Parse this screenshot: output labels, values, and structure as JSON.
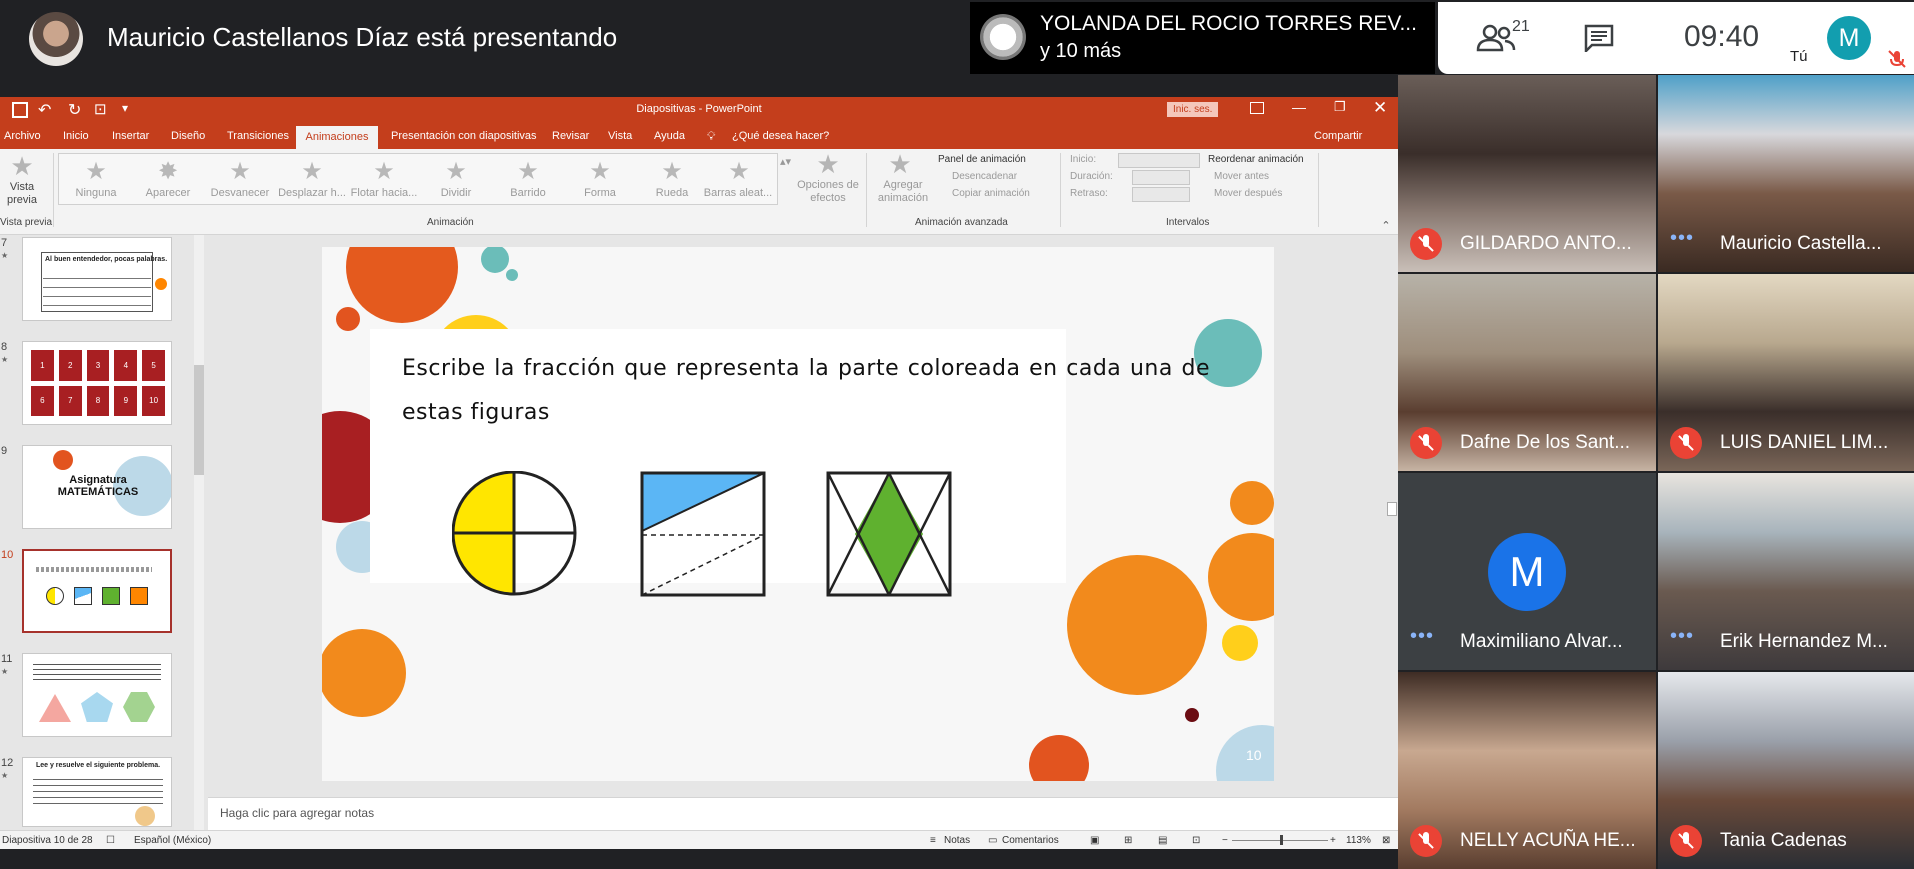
{
  "meet": {
    "presenter_text": "Mauricio Castellanos Díaz está presentando",
    "speaker": {
      "name": "YOLANDA DEL ROCIO TORRES REV...",
      "more": "y 10 más"
    },
    "participants_count": "21",
    "clock": "09:40",
    "self_label": "Tú",
    "self_initial": "M"
  },
  "ppt": {
    "doc_title": "Diapositivas - PowerPoint",
    "signin": "Inic. ses.",
    "tabs": [
      "Archivo",
      "Inicio",
      "Insertar",
      "Diseño",
      "Transiciones",
      "Animaciones",
      "Presentación con diapositivas",
      "Revisar",
      "Vista",
      "Ayuda"
    ],
    "active_tab": "Animaciones",
    "tell_me": "¿Qué desea hacer?",
    "share": "Compartir",
    "ribbon": {
      "preview": "Vista previa",
      "preview_group": "Vista previa",
      "animations": [
        "Ninguna",
        "Aparecer",
        "Desvanecer",
        "Desplazar h...",
        "Flotar hacia...",
        "Dividir",
        "Barrido",
        "Forma",
        "Rueda",
        "Barras aleat..."
      ],
      "effect_options": "Opciones de efectos",
      "animation_group": "Animación",
      "add_animation": "Agregar animación",
      "animation_pane": "Panel de animación",
      "trigger": "Desencadenar",
      "copy_animation": "Copiar animación",
      "advanced_group": "Animación avanzada",
      "start": "Inicio:",
      "duration": "Duración:",
      "delay": "Retraso:",
      "timing_group": "Intervalos",
      "reorder": "Reordenar animación",
      "move_earlier": "Mover antes",
      "move_later": "Mover después"
    },
    "thumbnails": [
      {
        "num": "7",
        "text": "Al buen entendedor, pocas palabras."
      },
      {
        "num": "8",
        "cells": [
          "1",
          "2",
          "3",
          "4",
          "5",
          "6",
          "7",
          "8",
          "9",
          "10"
        ]
      },
      {
        "num": "9",
        "text": "Asignatura MATEMÁTICAS"
      },
      {
        "num": "10"
      },
      {
        "num": "11"
      },
      {
        "num": "12",
        "text": "Lee y resuelve el siguiente problema."
      }
    ],
    "slide": {
      "instruction": "Escribe la fracción que representa la parte coloreada en cada una de estas figuras",
      "number": "10"
    },
    "notes_placeholder": "Haga clic para agregar notas",
    "status": {
      "slide_info": "Diapositiva 10 de 28",
      "language": "Español (México)",
      "notes": "Notas",
      "comments": "Comentarios",
      "zoom": "113%"
    },
    "colors": {
      "accent": "#c43e1c",
      "yellow": "#ffe600",
      "blue": "#5bb6f5",
      "green": "#5fb12f",
      "orange": "#ff8600"
    }
  },
  "tiles": [
    {
      "name": "GILDARDO ANTO...",
      "muted": true
    },
    {
      "name": "Mauricio Castella...",
      "muted": false
    },
    {
      "name": "Dafne De los Sant...",
      "muted": true
    },
    {
      "name": "LUIS DANIEL LIM...",
      "muted": true
    },
    {
      "name": "Maximiliano Alvar...",
      "muted": false,
      "initial": "M"
    },
    {
      "name": "Erik Hernandez M...",
      "muted": false
    },
    {
      "name": "NELLY ACUÑA HE...",
      "muted": true
    },
    {
      "name": "Tania Cadenas",
      "muted": true
    }
  ]
}
